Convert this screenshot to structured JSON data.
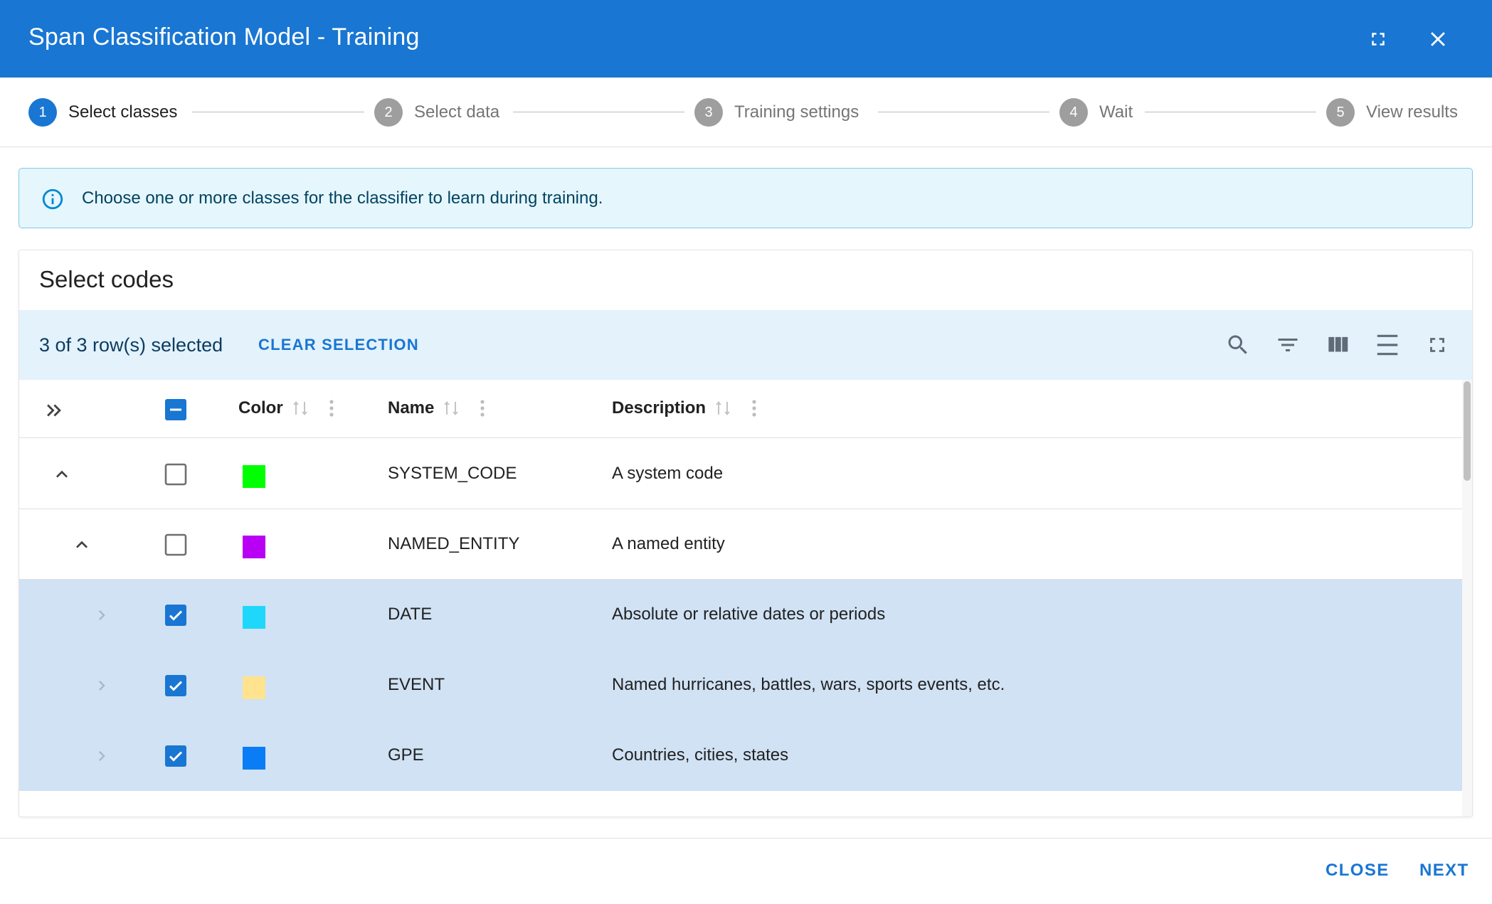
{
  "header": {
    "title": "Span Classification Model - Training"
  },
  "stepper": {
    "steps": [
      {
        "number": "1",
        "label": "Select classes",
        "active": true
      },
      {
        "number": "2",
        "label": "Select data",
        "active": false
      },
      {
        "number": "3",
        "label": "Training settings",
        "active": false
      },
      {
        "number": "4",
        "label": "Wait",
        "active": false
      },
      {
        "number": "5",
        "label": "View results",
        "active": false
      }
    ]
  },
  "alert": {
    "text": "Choose one or more classes for the classifier to learn during training."
  },
  "card": {
    "title": "Select codes",
    "selection_text": "3 of 3 row(s) selected",
    "clear_selection": "CLEAR SELECTION",
    "columns": {
      "color": "Color",
      "name": "Name",
      "description": "Description"
    },
    "rows": [
      {
        "name": "SYSTEM_CODE",
        "description": "A system code",
        "color": "#00ff00",
        "checked": false,
        "level": 0,
        "expand": "expanded"
      },
      {
        "name": "NAMED_ENTITY",
        "description": "A named entity",
        "color": "#b800f5",
        "checked": false,
        "level": 1,
        "expand": "expanded"
      },
      {
        "name": "DATE",
        "description": "Absolute or relative dates or periods",
        "color": "#1ed7fb",
        "checked": true,
        "level": 2,
        "expand": "collapsed"
      },
      {
        "name": "EVENT",
        "description": "Named hurricanes, battles, wars, sports events, etc.",
        "color": "#ffe38f",
        "checked": true,
        "level": 2,
        "expand": "collapsed"
      },
      {
        "name": "GPE",
        "description": "Countries, cities, states",
        "color": "#0a7cf5",
        "checked": true,
        "level": 2,
        "expand": "collapsed"
      }
    ]
  },
  "footer": {
    "close_label": "CLOSE",
    "next_label": "NEXT"
  },
  "colors": {
    "primary": "#1976d2",
    "selected_row": "#d0e2f4",
    "toolbar_bg": "#e3f2fb",
    "alert_bg": "#e5f6fd"
  }
}
